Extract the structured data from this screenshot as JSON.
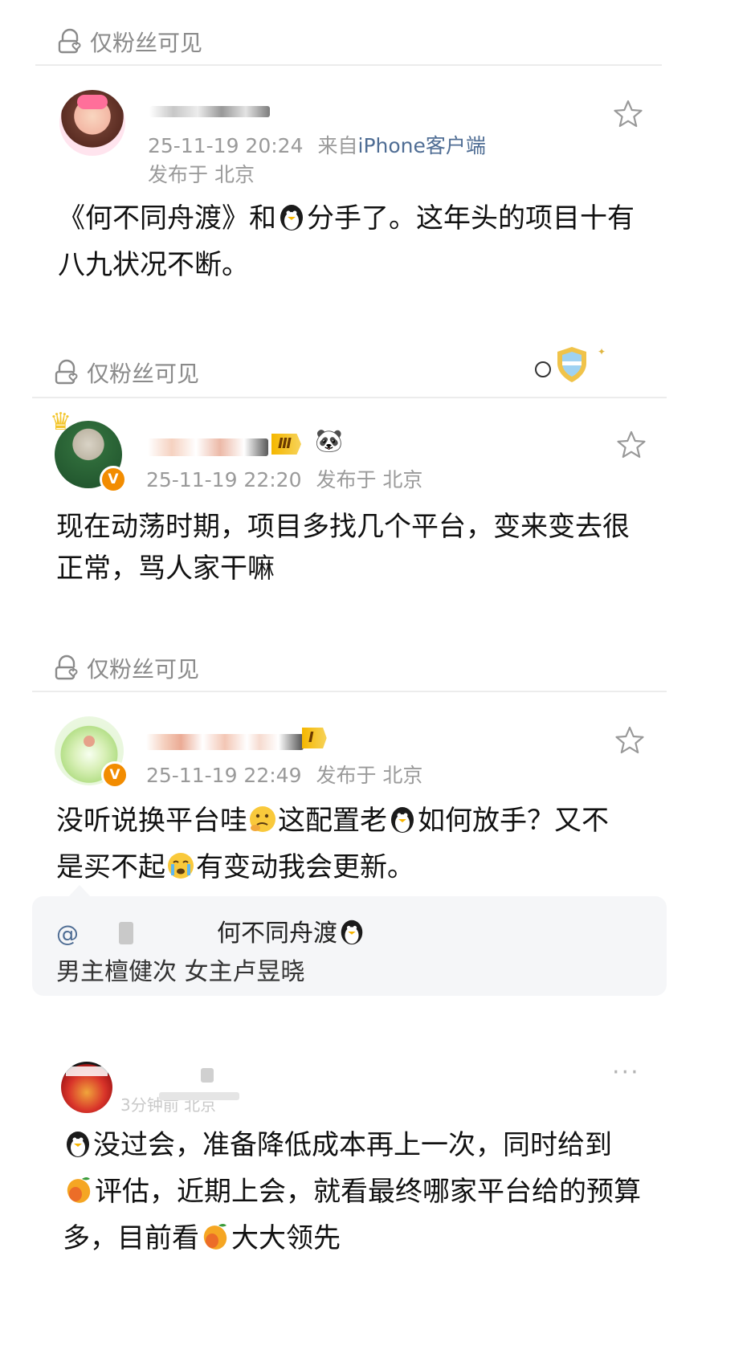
{
  "fans_only_label": "仅粉丝可见",
  "posts": [
    {
      "time": "25-11-19 20:24",
      "source_prefix": "来自",
      "source_client": "iPhone客户端",
      "location": "发布于 北京",
      "text_before": "《何不同舟渡》和",
      "text_after": "分手了。这年头的项目十有八九状况不断。"
    },
    {
      "time": "25-11-19 22:20",
      "location": "发布于 北京",
      "level": "Ⅲ",
      "text": "现在动荡时期，项目多找几个平台，变来变去很正常，骂人家干嘛"
    },
    {
      "time": "25-11-19 22:49",
      "location": "发布于 北京",
      "level": "I",
      "text_part1": "没听说换平台哇",
      "text_part2": "这配置老",
      "text_part3": "如何放手？又不是买不起",
      "text_part4": "有变动我会更新。",
      "quote": {
        "mention_icon": "@",
        "title": "何不同舟渡",
        "line2": "男主檀健次 女主卢昱晓"
      }
    },
    {
      "meta_partial": "3分钟前 北京",
      "text_part1": "没过会，准备降低成本再上一次，同时给到",
      "text_part2": "评估，近期上会，就看最终哪家平台给的预算多，目前看",
      "text_part3": "大大领先",
      "more_icon": "···"
    }
  ],
  "icons": {
    "lock": "lock-heart-icon",
    "star": "star-icon",
    "penguin": "penguin-emoji",
    "mango": "mango-emoji",
    "thinking": "thinking-emoji",
    "crying": "crying-emoji",
    "panda": "panda-emoji"
  },
  "colors": {
    "meta": "#9a9a9a",
    "client_link": "#4f6d94",
    "badge_orange": "#f28c00",
    "divider": "#ececec"
  }
}
